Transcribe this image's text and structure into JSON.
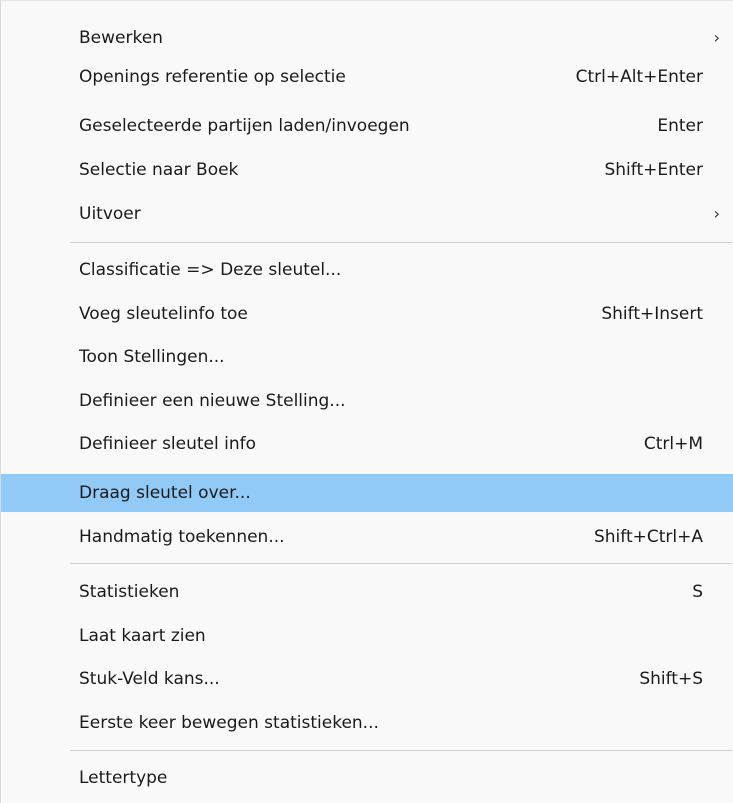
{
  "menu": {
    "items": [
      {
        "label": "Bewerken",
        "shortcut": "",
        "submenu_arrow": "›"
      },
      {
        "label": "Openings referentie op selectie",
        "shortcut": "Ctrl+Alt+Enter"
      },
      {
        "label": "Geselecteerde partijen laden/invoegen",
        "shortcut": "Enter"
      },
      {
        "label": "Selectie naar Boek",
        "shortcut": "Shift+Enter"
      },
      {
        "label": "Uitvoer",
        "shortcut": "",
        "submenu_arrow": "›"
      },
      {
        "label": "Classificatie => Deze sleutel...",
        "shortcut": ""
      },
      {
        "label": "Voeg sleutelinfo toe",
        "shortcut": "Shift+Insert"
      },
      {
        "label": "Toon Stellingen...",
        "shortcut": ""
      },
      {
        "label": "Definieer een nieuwe Stelling...",
        "shortcut": ""
      },
      {
        "label": "Definieer sleutel info",
        "shortcut": "Ctrl+M"
      },
      {
        "label": "Draag sleutel over...",
        "shortcut": "",
        "highlighted": true
      },
      {
        "label": "Handmatig toekennen...",
        "shortcut": "Shift+Ctrl+A"
      },
      {
        "label": "Statistieken",
        "shortcut": "S"
      },
      {
        "label": "Laat kaart zien",
        "shortcut": ""
      },
      {
        "label": "Stuk-Veld kans...",
        "shortcut": "Shift+S"
      },
      {
        "label": "Eerste keer bewegen statistieken...",
        "shortcut": ""
      },
      {
        "label": "Lettertype",
        "shortcut": ""
      }
    ],
    "highlight_color": "#91c9f7"
  }
}
